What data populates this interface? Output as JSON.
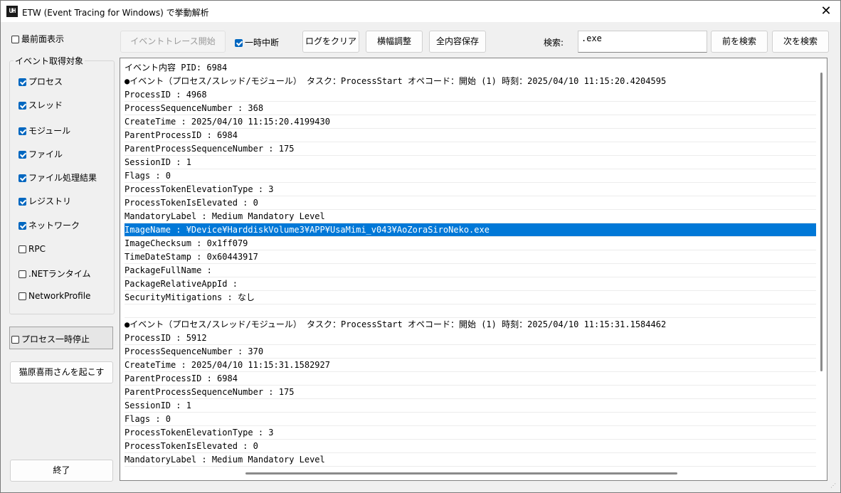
{
  "window": {
    "title": "ETW (Event Tracing for Windows) で挙動解析",
    "app_icon_text": "UH",
    "close_glyph": "✕"
  },
  "topmost": {
    "label": "最前面表示",
    "checked": false
  },
  "event_group": {
    "title": "イベント取得対象",
    "items": [
      {
        "label": "プロセス",
        "checked": true
      },
      {
        "label": "スレッド",
        "checked": true
      },
      {
        "label": "モジュール",
        "checked": true
      },
      {
        "label": "ファイル",
        "checked": true
      },
      {
        "label": "ファイル処理結果",
        "checked": true
      },
      {
        "label": "レジストリ",
        "checked": true
      },
      {
        "label": "ネットワーク",
        "checked": true
      },
      {
        "label": "RPC",
        "checked": false
      },
      {
        "label": ".NETランタイム",
        "checked": false
      },
      {
        "label": "NetworkProfile",
        "checked": false
      }
    ]
  },
  "process_pause": {
    "label": "プロセス一時停止",
    "checked": false
  },
  "wake_button": "猫原喜雨さんを起こす",
  "exit_button": "終了",
  "toolbar": {
    "start_trace": "イベントトレース開始",
    "suspend": {
      "label": "一時中断",
      "checked": true
    },
    "clear_log": "ログをクリア",
    "fit_width": "横幅調整",
    "save_all": "全内容保存",
    "search_label": "検索:",
    "search_value": ".exe",
    "search_prev": "前を検索",
    "search_next": "次を検索"
  },
  "log": {
    "lines": [
      "イベント内容  PID: 6984",
      "●イベント（プロセス/スレッド/モジュール）  タスク：ProcessStart  オペコード：開始 (1)  時刻：2025/04/10 11:15:20.4204595",
      "ProcessID : 4968",
      "ProcessSequenceNumber : 368",
      "CreateTime : 2025/04/10 11:15:20.4199430",
      "ParentProcessID : 6984",
      "ParentProcessSequenceNumber : 175",
      "SessionID : 1",
      "Flags : 0",
      "ProcessTokenElevationType : 3",
      "ProcessTokenIsElevated : 0",
      "MandatoryLabel : Medium Mandatory Level",
      "ImageName : ¥Device¥HarddiskVolume3¥APP¥UsaMimi_v043¥AoZoraSiroNeko.exe",
      "ImageChecksum : 0x1ff079",
      "TimeDateStamp : 0x60443917",
      "PackageFullName :",
      "PackageRelativeAppId :",
      "SecurityMitigations : なし",
      "",
      "●イベント（プロセス/スレッド/モジュール）  タスク：ProcessStart  オペコード：開始 (1)  時刻：2025/04/10 11:15:31.1584462",
      "ProcessID : 5912",
      "ProcessSequenceNumber : 370",
      "CreateTime : 2025/04/10 11:15:31.1582927",
      "ParentProcessID : 6984",
      "ParentProcessSequenceNumber : 175",
      "SessionID : 1",
      "Flags : 0",
      "ProcessTokenElevationType : 3",
      "ProcessTokenIsElevated : 0",
      "MandatoryLabel : Medium Mandatory Level"
    ],
    "selected_index": 12
  }
}
